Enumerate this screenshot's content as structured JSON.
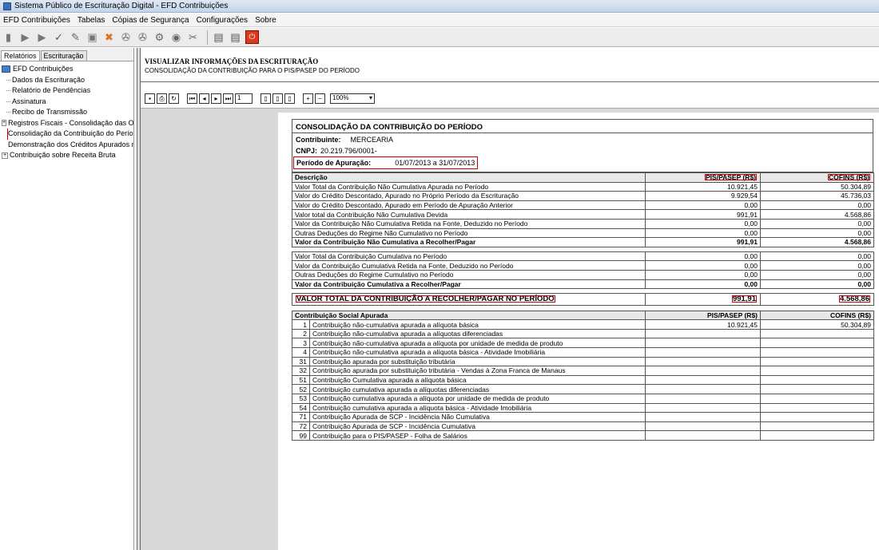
{
  "window": {
    "title": "Sistema Público de Escrituração Digital - EFD Contribuições"
  },
  "menu": [
    "EFD Contribuições",
    "Tabelas",
    "Cópias de Segurança",
    "Configurações",
    "Sobre"
  ],
  "left": {
    "tabs": [
      "Relatórios",
      "Escrituração"
    ],
    "root": "EFD Contribuições",
    "items": [
      {
        "label": "Dados da Escrituração",
        "expandable": false
      },
      {
        "label": "Relatório de Pendências",
        "expandable": false
      },
      {
        "label": "Assinatura",
        "expandable": false
      },
      {
        "label": "Recibo de Transmissão",
        "expandable": false
      },
      {
        "label": "Registros Fiscais - Consolidação das Operaçõ",
        "expandable": true
      },
      {
        "label": "Consolidação da Contribuição do Período",
        "expandable": false,
        "selected": true
      },
      {
        "label": "Demonstração dos Créditos Apurados no Perí",
        "expandable": false
      },
      {
        "label": "Contribuição sobre Receita Bruta",
        "expandable": true
      }
    ]
  },
  "right": {
    "header_title": "VISUALIZAR INFORMAÇÕES DA ESCRITURAÇÃO",
    "header_subtitle": "CONSOLIDAÇÃO DA CONTRIBUIÇÃO PARA O PIS/PASEP DO PERÍODO",
    "viewer": {
      "page": "1",
      "zoom": "100%"
    }
  },
  "report": {
    "title": "CONSOLIDAÇÃO DA CONTRIBUIÇÃO DO PERÍODO",
    "contribuinte_label": "Contribuinte:",
    "contribuinte": "MERCEARIA",
    "cnpj_label": "CNPJ:",
    "cnpj": "20.219.796/0001-",
    "periodo_label": "Período de Apuração:",
    "periodo": "01/07/2013 a 31/07/2013",
    "col_desc": "Descrição",
    "col_pis": "PIS/PASEP (R$)",
    "col_cofins": "COFINS (R$)",
    "rows_nc": [
      {
        "desc": "Valor Total da Contribuição Não Cumulativa Apurada no Período",
        "pis": "10.921,45",
        "cofins": "50.304,89"
      },
      {
        "desc": "Valor do Crédito Descontado, Apurado no Próprio Período da Escrituração",
        "pis": "9.929,54",
        "cofins": "45.736,03"
      },
      {
        "desc": "Valor do Crédito Descontado, Apurado em Período de Apuração Anterior",
        "pis": "0,00",
        "cofins": "0,00"
      },
      {
        "desc": "Valor total da Contribuição Não Cumulativa Devida",
        "pis": "991,91",
        "cofins": "4.568,86"
      },
      {
        "desc": "Valor da Contribuição Não Cumulativa Retida na Fonte, Deduzido no Período",
        "pis": "0,00",
        "cofins": "0,00"
      },
      {
        "desc": "Outras Deduções do Regime Não Cumulativo no Período",
        "pis": "0,00",
        "cofins": "0,00"
      }
    ],
    "row_nc_total": {
      "desc": "Valor da Contribuição Não Cumulativa a Recolher/Pagar",
      "pis": "991,91",
      "cofins": "4.568,86"
    },
    "rows_c": [
      {
        "desc": "Valor Total da Contribuição Cumulativa no Período",
        "pis": "0,00",
        "cofins": "0,00"
      },
      {
        "desc": "Valor da Contribuição Cumulativa Retida na Fonte, Deduzido no Período",
        "pis": "0,00",
        "cofins": "0,00"
      },
      {
        "desc": "Outras Deduções do Regime Cumulativo no Período",
        "pis": "0,00",
        "cofins": "0,00"
      }
    ],
    "row_c_total": {
      "desc": "Valor da Contribuição Cumulativa a Recolher/Pagar",
      "pis": "0,00",
      "cofins": "0,00"
    },
    "grand_total": {
      "desc": "VALOR TOTAL DA CONTRIBUIÇÃO A RECOLHER/PAGAR NO PERÍODO",
      "pis": "991,91",
      "cofins": "4.568,86"
    },
    "sc_header": "Contribuição Social Apurada",
    "sc_rows": [
      {
        "code": "1",
        "desc": "Contribuição não-cumulativa apurada a alíquota básica",
        "pis": "10.921,45",
        "cofins": "50.304,89"
      },
      {
        "code": "2",
        "desc": "Contribuição não-cumulativa apurada a alíquotas diferenciadas",
        "pis": "",
        "cofins": ""
      },
      {
        "code": "3",
        "desc": "Contribuição não-cumulativa apurada a alíquota por unidade de medida de produto",
        "pis": "",
        "cofins": ""
      },
      {
        "code": "4",
        "desc": "Contribuição não-cumulativa apurada a alíquota básica - Atividade Imobiliária",
        "pis": "",
        "cofins": ""
      },
      {
        "code": "31",
        "desc": "Contribuição apurada por substituição tributária",
        "pis": "",
        "cofins": ""
      },
      {
        "code": "32",
        "desc": "Contribuição apurada por substituição tributária - Vendas à Zona Franca de Manaus",
        "pis": "",
        "cofins": ""
      },
      {
        "code": "51",
        "desc": "Contribuição Cumulativa apurada a alíquota básica",
        "pis": "",
        "cofins": ""
      },
      {
        "code": "52",
        "desc": "Contribuição cumulativa apurada a alíquotas diferenciadas",
        "pis": "",
        "cofins": ""
      },
      {
        "code": "53",
        "desc": "Contribuição cumulativa apurada a alíquota por unidade de medida de produto",
        "pis": "",
        "cofins": ""
      },
      {
        "code": "54",
        "desc": "Contribuição cumulativa apurada a alíquota básica - Atividade Imobiliária",
        "pis": "",
        "cofins": ""
      },
      {
        "code": "71",
        "desc": "Contribuição Apurada de SCP - Incidência Não Cumulativa",
        "pis": "",
        "cofins": ""
      },
      {
        "code": "72",
        "desc": "Contribuição Apurada de SCP - Incidência Cumulativa",
        "pis": "",
        "cofins": ""
      },
      {
        "code": "99",
        "desc": "Contribuição para o PIS/PASEP - Folha de Salários",
        "pis": "",
        "cofins": ""
      }
    ]
  }
}
